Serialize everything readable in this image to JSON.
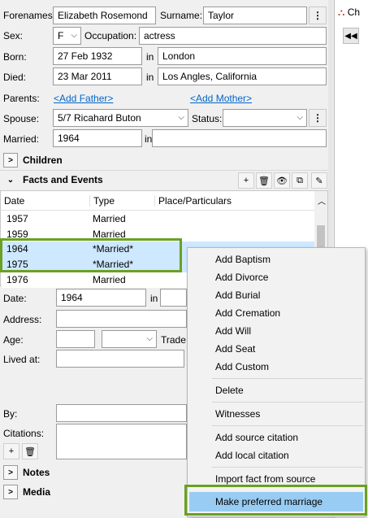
{
  "person": {
    "forenames_label": "Forenames:",
    "forenames": "Elizabeth Rosemond",
    "surname_label": "Surname:",
    "surname": "Taylor",
    "sex_label": "Sex:",
    "sex": "F",
    "occupation_label": "Occupation:",
    "occupation": "actress",
    "born_label": "Born:",
    "born_date": "27 Feb 1932",
    "in_label": "in",
    "born_place": "London",
    "died_label": "Died:",
    "died_date": "23 Mar 2011",
    "died_place": "Los Angles, California",
    "parents_label": "Parents:",
    "add_father": "<Add Father>",
    "add_mother": "<Add Mother>",
    "spouse_label": "Spouse:",
    "spouse": "5/7 Ricahard Buton",
    "status_label": "Status:",
    "status": "",
    "married_label": "Married:",
    "married_date": "1964",
    "married_place": ""
  },
  "sections": {
    "children": "Children",
    "facts": "Facts and Events",
    "notes": "Notes",
    "media": "Media"
  },
  "facts_table": {
    "columns": [
      "Date",
      "Type",
      "Place/Particulars"
    ],
    "rows": [
      {
        "date": "1957",
        "type": "Married"
      },
      {
        "date": "1959",
        "type": "Married"
      },
      {
        "date": "1964",
        "type": "*Married*"
      },
      {
        "date": "1975",
        "type": "*Married*"
      },
      {
        "date": "1976",
        "type": "Married"
      }
    ]
  },
  "detail": {
    "date_label": "Date:",
    "date": "1964",
    "in_label": "in",
    "address_label": "Address:",
    "age_label": "Age:",
    "trade_label": "Trade:",
    "lived_label": "Lived at:",
    "by_label": "By:",
    "citations_label": "Citations:"
  },
  "context_menu": {
    "items": [
      "Add Baptism",
      "Add Divorce",
      "Add Burial",
      "Add Cremation",
      "Add Will",
      "Add Seat",
      "Add Custom",
      "Delete",
      "Witnesses",
      "Add source citation",
      "Add local citation",
      "Import fact from source",
      "Make preferred marriage"
    ]
  },
  "right_panel": {
    "tab_label": "Ch"
  },
  "colors": {
    "highlight_border": "#6aa121",
    "menu_selected": "#99ccf3",
    "link": "#0066cc"
  }
}
